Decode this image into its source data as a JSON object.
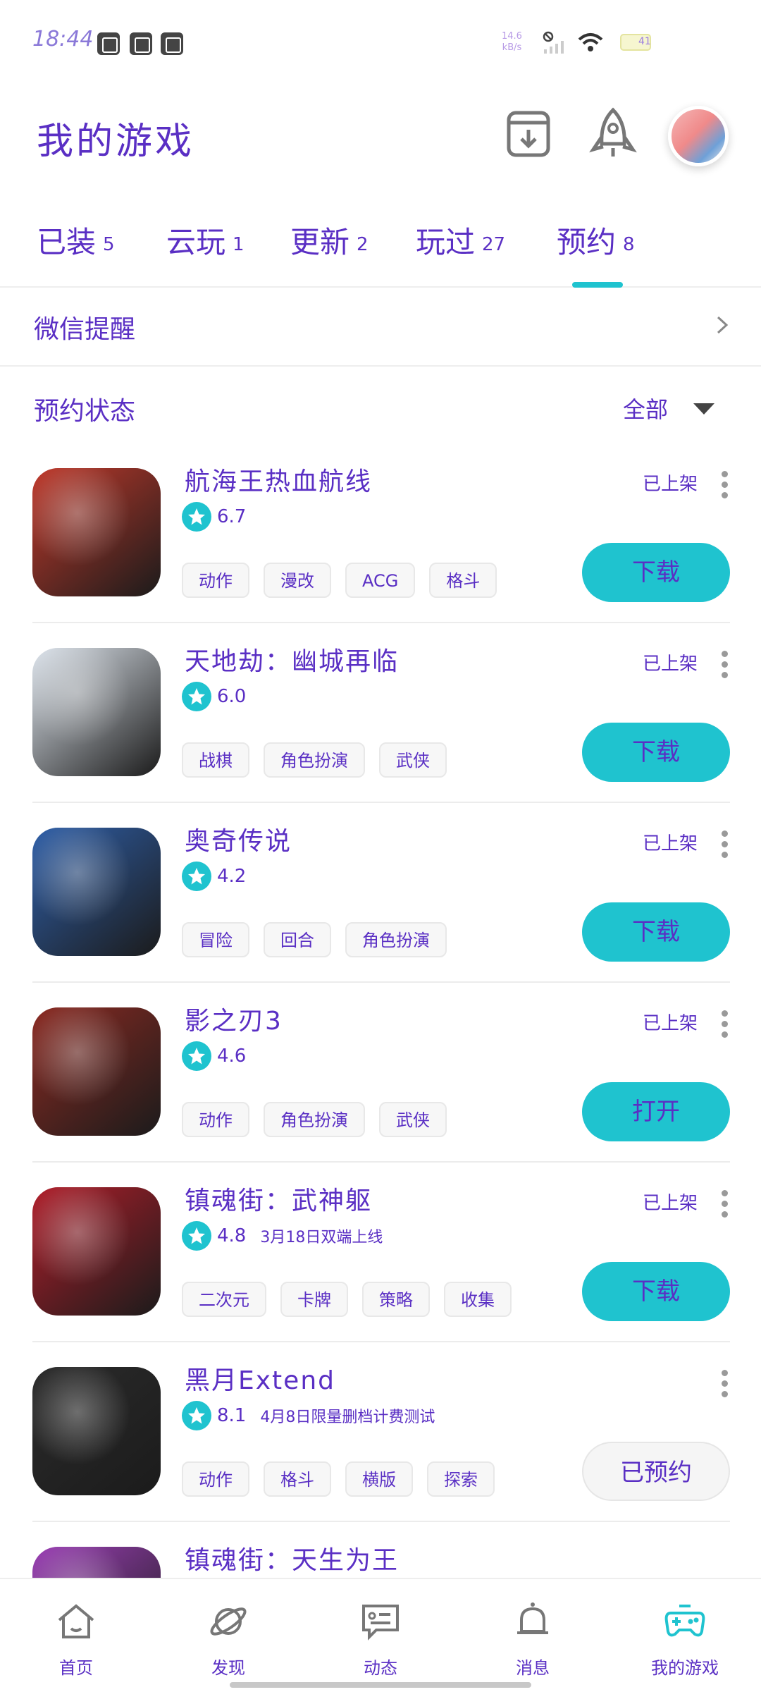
{
  "status_bar": {
    "time": "18:44",
    "net_speed_value": "14.6",
    "net_speed_unit": "kB/s",
    "battery": "41"
  },
  "header": {
    "title": "我的游戏"
  },
  "tabs": [
    {
      "label": "已装",
      "count": "5"
    },
    {
      "label": "云玩",
      "count": "1"
    },
    {
      "label": "更新",
      "count": "2"
    },
    {
      "label": "玩过",
      "count": "27"
    },
    {
      "label": "预约",
      "count": "8"
    }
  ],
  "active_tab": "预约",
  "wechat_reminder": {
    "label": "微信提醒"
  },
  "filter": {
    "label": "预约状态",
    "value": "全部"
  },
  "games": [
    {
      "name": "航海王热血航线",
      "rating": "6.7",
      "note": "",
      "tags": [
        "动作",
        "漫改",
        "ACG",
        "格斗"
      ],
      "status": "已上架",
      "action": "下载",
      "reserved": false
    },
    {
      "name": "天地劫：幽城再临",
      "rating": "6.0",
      "note": "",
      "tags": [
        "战棋",
        "角色扮演",
        "武侠"
      ],
      "status": "已上架",
      "action": "下载",
      "reserved": false
    },
    {
      "name": "奥奇传说",
      "rating": "4.2",
      "note": "",
      "tags": [
        "冒险",
        "回合",
        "角色扮演"
      ],
      "status": "已上架",
      "action": "下载",
      "reserved": false
    },
    {
      "name": "影之刃3",
      "rating": "4.6",
      "note": "",
      "tags": [
        "动作",
        "角色扮演",
        "武侠"
      ],
      "status": "已上架",
      "action": "打开",
      "reserved": false
    },
    {
      "name": "镇魂街：武神躯",
      "rating": "4.8",
      "note": "3月18日双端上线",
      "tags": [
        "二次元",
        "卡牌",
        "策略",
        "收集"
      ],
      "status": "已上架",
      "action": "下载",
      "reserved": false
    },
    {
      "name": "黑月Extend",
      "rating": "8.1",
      "note": "4月8日限量删档计费测试",
      "tags": [
        "动作",
        "格斗",
        "横版",
        "探索"
      ],
      "status": "",
      "action": "已预约",
      "reserved": true
    },
    {
      "name": "镇魂街：天生为王",
      "rating": "",
      "note": "",
      "tags": [],
      "status": "",
      "action": "",
      "reserved": false
    }
  ],
  "icon_colors": [
    "#c0392b",
    "#dfe6ee",
    "#2f5fa8",
    "#8b2a22",
    "#b01e2a",
    "#2b2b2b",
    "#9b3fb5"
  ],
  "bottom_nav": [
    {
      "label": "首页",
      "icon": "home-icon"
    },
    {
      "label": "发现",
      "icon": "planet-icon"
    },
    {
      "label": "动态",
      "icon": "chat-icon"
    },
    {
      "label": "消息",
      "icon": "bell-icon"
    },
    {
      "label": "我的游戏",
      "icon": "gamepad-icon"
    }
  ],
  "colors": {
    "accent": "#1fc3cf",
    "text": "#5a2fc4"
  }
}
